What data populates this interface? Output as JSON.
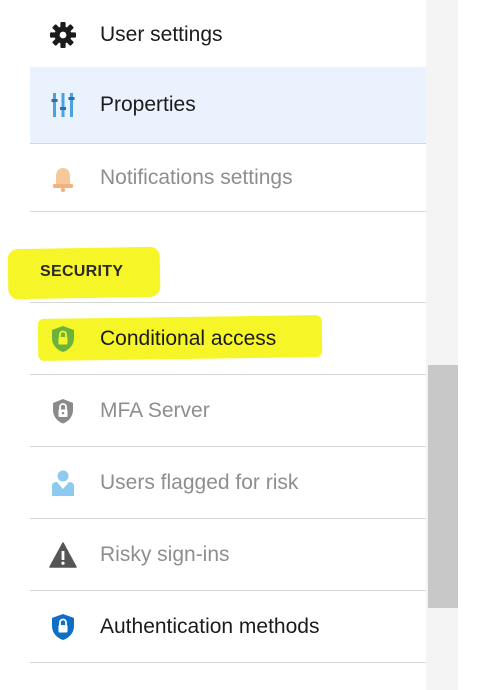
{
  "menu": {
    "items": [
      {
        "label": "User settings",
        "icon": "gear-icon"
      },
      {
        "label": "Properties",
        "icon": "properties-icon"
      },
      {
        "label": "Notifications settings",
        "icon": "bell-icon"
      }
    ],
    "security": {
      "heading": "SECURITY",
      "items": [
        {
          "label": "Conditional access",
          "icon": "shield-lock-icon"
        },
        {
          "label": "MFA Server",
          "icon": "mfa-lock-icon"
        },
        {
          "label": "Users flagged for risk",
          "icon": "user-flag-icon"
        },
        {
          "label": "Risky sign-ins",
          "icon": "warning-icon"
        },
        {
          "label": "Authentication methods",
          "icon": "auth-shield-icon"
        }
      ]
    }
  },
  "colors": {
    "active_background": "#eaf3fd",
    "highlighter": "#f5f527",
    "text": "#1b1b1b",
    "disabled_text": "#8e8e8e",
    "divider": "#d6d6d6",
    "scroll_thumb": "#c8c8c8"
  }
}
